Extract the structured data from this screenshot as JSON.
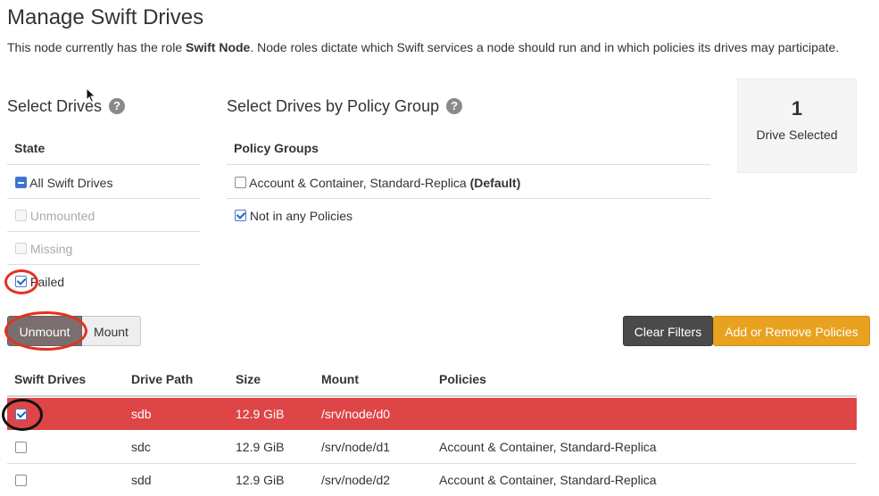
{
  "page": {
    "title": "Manage Swift Drives",
    "intro_before": "This node currently has the role ",
    "intro_role": "Swift Node",
    "intro_after": ". Node roles dictate which Swift services a node should run and in which policies its drives may participate."
  },
  "select_drives": {
    "title": "Select Drives",
    "help_glyph": "?",
    "state_header": "State",
    "items": [
      {
        "label": "All Swift Drives",
        "state": "indeterminate",
        "enabled": true
      },
      {
        "label": "Unmounted",
        "state": "unchecked",
        "enabled": false
      },
      {
        "label": "Missing",
        "state": "unchecked",
        "enabled": false
      },
      {
        "label": "Failed",
        "state": "checked",
        "enabled": true
      }
    ]
  },
  "policy_groups": {
    "title": "Select Drives by Policy Group",
    "help_glyph": "?",
    "header": "Policy Groups",
    "items": [
      {
        "label": "Account & Container, Standard-Replica",
        "suffix": "(Default)",
        "checked": false
      },
      {
        "label": "Not in any Policies",
        "suffix": "",
        "checked": true
      }
    ]
  },
  "summary": {
    "count": "1",
    "label": "Drive Selected"
  },
  "actions": {
    "unmount": "Unmount",
    "mount": "Mount",
    "clear_filters": "Clear Filters",
    "add_remove_policies": "Add or Remove Policies"
  },
  "drives_table": {
    "columns": [
      "Swift Drives",
      "Drive Path",
      "Size",
      "Mount",
      "Policies"
    ],
    "rows": [
      {
        "path": "sdb",
        "size": "12.9 GiB",
        "mount": "/srv/node/d0",
        "policies": "",
        "checked": true,
        "status": "failed"
      },
      {
        "path": "sdc",
        "size": "12.9 GiB",
        "mount": "/srv/node/d1",
        "policies": "Account & Container, Standard-Replica",
        "checked": false,
        "status": "ok"
      },
      {
        "path": "sdd",
        "size": "12.9 GiB",
        "mount": "/srv/node/d2",
        "policies": "Account & Container, Standard-Replica",
        "checked": false,
        "status": "ok"
      }
    ]
  },
  "colors": {
    "failed_row": "#de4546",
    "primary_orange": "#e8a21f",
    "annotation_red": "#e3321f",
    "annotation_black": "#111111"
  }
}
